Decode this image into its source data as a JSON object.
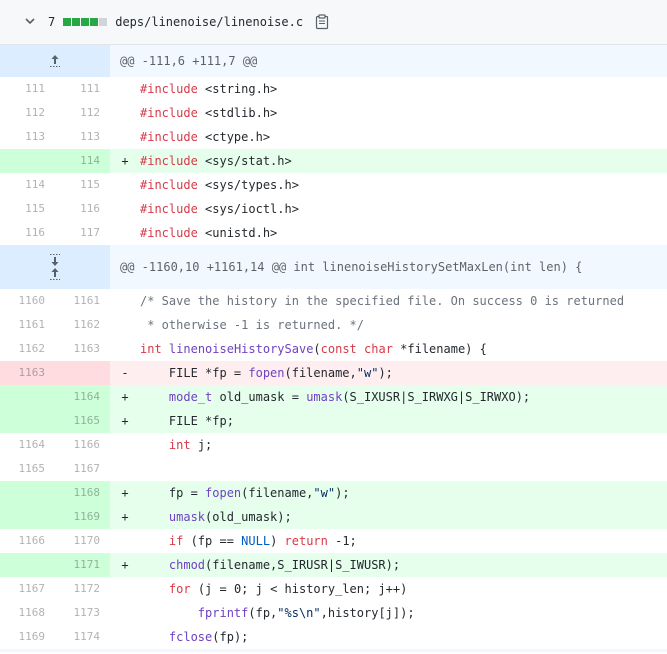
{
  "file": {
    "changes": "7",
    "blocks": [
      "add",
      "add",
      "add",
      "add",
      "neutral"
    ],
    "path": "deps/linenoise/linenoise.c",
    "icons": {
      "collapse": "chevron-down-icon",
      "copy": "clipboard-icon"
    },
    "colors": {
      "add": "#28a745",
      "addBg": "#e6ffed",
      "delBg": "#ffeef0",
      "hunkBg": "#f1f8ff"
    }
  },
  "hunks": [
    {
      "header": "@@ -111,6 +111,7 @@"
    },
    {
      "header": "@@ -1160,10 +1161,14 @@ int linenoiseHistorySetMaxLen(int len) {"
    }
  ],
  "lines": [
    {
      "type": "ctx",
      "old": "111",
      "new": "111",
      "sign": "",
      "code": "#include <string.h>"
    },
    {
      "type": "ctx",
      "old": "112",
      "new": "112",
      "sign": "",
      "code": "#include <stdlib.h>"
    },
    {
      "type": "ctx",
      "old": "113",
      "new": "113",
      "sign": "",
      "code": "#include <ctype.h>"
    },
    {
      "type": "add",
      "old": "",
      "new": "114",
      "sign": "+",
      "code": "#include <sys/stat.h>"
    },
    {
      "type": "ctx",
      "old": "114",
      "new": "115",
      "sign": "",
      "code": "#include <sys/types.h>"
    },
    {
      "type": "ctx",
      "old": "115",
      "new": "116",
      "sign": "",
      "code": "#include <sys/ioctl.h>"
    },
    {
      "type": "ctx",
      "old": "116",
      "new": "117",
      "sign": "",
      "code": "#include <unistd.h>"
    },
    {
      "type": "ctx",
      "old": "1160",
      "new": "1161",
      "sign": "",
      "code": "/* Save the history in the specified file. On success 0 is returned"
    },
    {
      "type": "ctx",
      "old": "1161",
      "new": "1162",
      "sign": "",
      "code": " * otherwise -1 is returned. */"
    },
    {
      "type": "ctx",
      "old": "1162",
      "new": "1163",
      "sign": "",
      "code": "int linenoiseHistorySave(const char *filename) {"
    },
    {
      "type": "del",
      "old": "1163",
      "new": "",
      "sign": "-",
      "code": "    FILE *fp = fopen(filename,\"w\");"
    },
    {
      "type": "add",
      "old": "",
      "new": "1164",
      "sign": "+",
      "code": "    mode_t old_umask = umask(S_IXUSR|S_IRWXG|S_IRWXO);"
    },
    {
      "type": "add",
      "old": "",
      "new": "1165",
      "sign": "+",
      "code": "    FILE *fp;"
    },
    {
      "type": "ctx",
      "old": "1164",
      "new": "1166",
      "sign": "",
      "code": "    int j;"
    },
    {
      "type": "ctx",
      "old": "1165",
      "new": "1167",
      "sign": "",
      "code": ""
    },
    {
      "type": "add",
      "old": "",
      "new": "1168",
      "sign": "+",
      "code": "    fp = fopen(filename,\"w\");"
    },
    {
      "type": "add",
      "old": "",
      "new": "1169",
      "sign": "+",
      "code": "    umask(old_umask);"
    },
    {
      "type": "ctx",
      "old": "1166",
      "new": "1170",
      "sign": "",
      "code": "    if (fp == NULL) return -1;"
    },
    {
      "type": "add",
      "old": "",
      "new": "1171",
      "sign": "+",
      "code": "    chmod(filename,S_IRUSR|S_IWUSR);"
    },
    {
      "type": "ctx",
      "old": "1167",
      "new": "1172",
      "sign": "",
      "code": "    for (j = 0; j < history_len; j++)"
    },
    {
      "type": "ctx",
      "old": "1168",
      "new": "1173",
      "sign": "",
      "code": "        fprintf(fp,\"%s\\n\",history[j]);"
    },
    {
      "type": "ctx",
      "old": "1169",
      "new": "1174",
      "sign": "",
      "code": "    fclose(fp);"
    }
  ]
}
